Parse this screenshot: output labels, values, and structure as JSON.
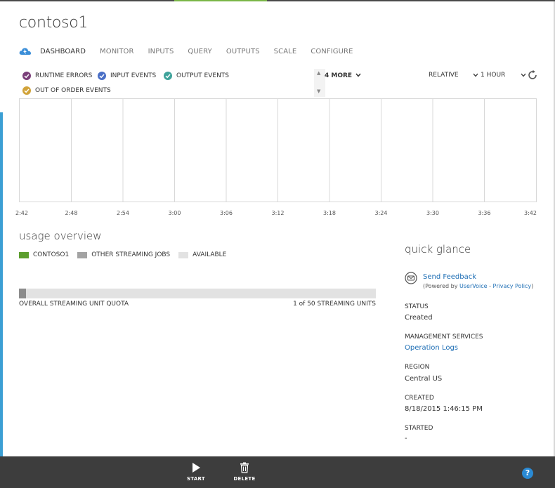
{
  "job": {
    "title": "contoso1"
  },
  "nav": {
    "tabs": [
      {
        "label": "DASHBOARD",
        "active": true
      },
      {
        "label": "MONITOR"
      },
      {
        "label": "INPUTS"
      },
      {
        "label": "QUERY"
      },
      {
        "label": "OUTPUTS"
      },
      {
        "label": "SCALE"
      },
      {
        "label": "CONFIGURE"
      }
    ]
  },
  "metrics": {
    "items": [
      {
        "label": "RUNTIME ERRORS",
        "color": "#7b3f7a",
        "checked": true
      },
      {
        "label": "INPUT EVENTS",
        "color": "#4a6fc6",
        "checked": true
      },
      {
        "label": "OUTPUT EVENTS",
        "color": "#3fa39b",
        "checked": true
      },
      {
        "label": "OUT OF ORDER EVENTS",
        "color": "#d1a33a",
        "checked": true
      }
    ],
    "more_label": "4 MORE"
  },
  "time_controls": {
    "mode": "RELATIVE",
    "range": "1 HOUR"
  },
  "chart": {
    "x_ticks": [
      "2:42",
      "2:48",
      "2:54",
      "3:00",
      "3:06",
      "3:12",
      "3:18",
      "3:24",
      "3:30",
      "3:36",
      "3:42"
    ]
  },
  "usage": {
    "title": "usage overview",
    "legend": [
      {
        "label": "CONTOSO1",
        "color": "#5c9e2e"
      },
      {
        "label": "OTHER STREAMING JOBS",
        "color": "#a3a3a3"
      },
      {
        "label": "AVAILABLE",
        "color": "#e2e2e2"
      }
    ],
    "quota_label": "OVERALL STREAMING UNIT QUOTA",
    "quota_units": "1 of 50 STREAMING UNITS",
    "quota_used": 1,
    "quota_total": 50
  },
  "quick_glance": {
    "title": "quick glance",
    "feedback": {
      "link": "Send Feedback",
      "powered_prefix": "(Powered by ",
      "uservoice": "UserVoice",
      "separator": " - ",
      "privacy": "Privacy Policy",
      "suffix": ")"
    },
    "fields": [
      {
        "label": "STATUS",
        "value": "Created"
      },
      {
        "label": "MANAGEMENT SERVICES",
        "value": "Operation Logs",
        "link": true
      },
      {
        "label": "REGION",
        "value": "Central US"
      },
      {
        "label": "CREATED",
        "value": "8/18/2015 1:46:15 PM"
      },
      {
        "label": "STARTED",
        "value": "-"
      }
    ]
  },
  "commands": {
    "start": "START",
    "delete": "DELETE",
    "help": "?"
  }
}
